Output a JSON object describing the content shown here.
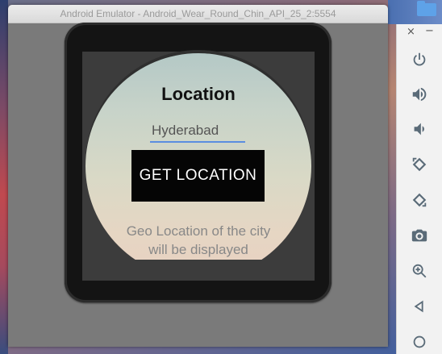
{
  "window": {
    "title": "Android Emulator - Android_Wear_Round_Chin_API_25_2:5554"
  },
  "app": {
    "heading": "Location",
    "city_input_value": "Hyderabad",
    "get_location_label": "GET LOCATION",
    "info_text": "Geo Location of the city will be displayed",
    "accent_color": "#5b8ee0"
  },
  "toolbar": {
    "close_glyph": "×",
    "minimize_glyph": "−",
    "icons": [
      "power-icon",
      "volume-up-icon",
      "volume-down-icon",
      "rotate-left-icon",
      "rotate-right-icon",
      "camera-icon",
      "zoom-icon",
      "back-icon",
      "home-icon"
    ]
  }
}
